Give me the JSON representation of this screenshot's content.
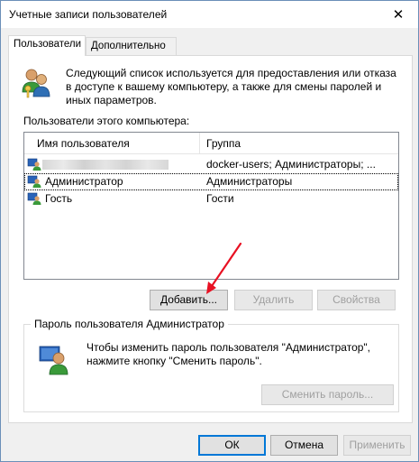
{
  "window": {
    "title": "Учетные записи пользователей",
    "close_glyph": "✕"
  },
  "tabs": [
    {
      "label": "Пользователи",
      "active": true
    },
    {
      "label": "Дополнительно",
      "active": false
    }
  ],
  "intro": {
    "icon": "users-icon",
    "text": "Следующий список используется для предоставления или отказа в доступе к вашему компьютеру, а также для смены паролей и иных параметров."
  },
  "users_list": {
    "label": "Пользователи этого компьютера:",
    "columns": [
      "Имя пользователя",
      "Группа"
    ],
    "rows": [
      {
        "name": "",
        "group": "docker-users; Администраторы; ...",
        "icon": "user-icon",
        "name_obscured": true,
        "selected": false
      },
      {
        "name": "Администратор",
        "group": "Администраторы",
        "icon": "user-icon",
        "name_obscured": false,
        "selected": true
      },
      {
        "name": "Гость",
        "group": "Гости",
        "icon": "user-icon",
        "name_obscured": false,
        "selected": false
      }
    ]
  },
  "list_buttons": {
    "add": "Добавить...",
    "remove": "Удалить",
    "properties": "Свойства"
  },
  "annotation": {
    "icon": "red-arrow-icon",
    "color": "#e81123"
  },
  "password_group": {
    "title": "Пароль пользователя Администратор",
    "icon": "user-key-icon",
    "text": "Чтобы изменить пароль пользователя \"Администратор\", нажмите кнопку \"Сменить пароль\".",
    "change_button": "Сменить пароль..."
  },
  "dialog_buttons": {
    "ok": "ОК",
    "cancel": "Отмена",
    "apply": "Применить"
  },
  "colors": {
    "accent": "#0078d7",
    "disabled_text": "#a0a0a0"
  }
}
